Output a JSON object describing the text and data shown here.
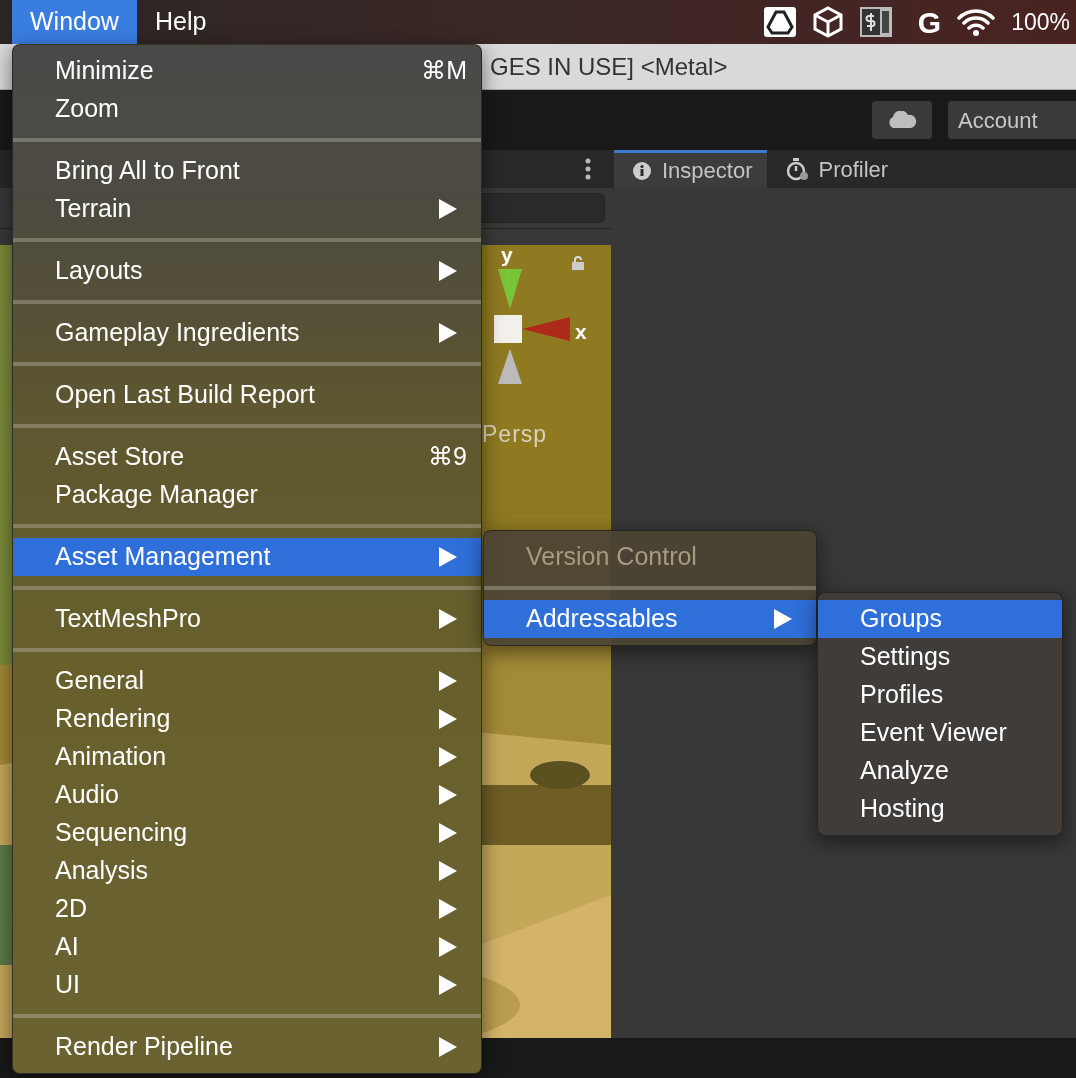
{
  "menu_bar": {
    "menus": [
      {
        "label": "Window",
        "selected": true
      },
      {
        "label": "Help",
        "selected": false
      }
    ],
    "status_letter": "G",
    "battery": "100%"
  },
  "window_title": "GES IN USE] <Metal>",
  "toolbar": {
    "account_button": "Account"
  },
  "scene": {
    "axis_y": "y",
    "axis_x": "x",
    "projection": "Persp"
  },
  "inspector_tabs": [
    {
      "label": "Inspector",
      "selected": true
    },
    {
      "label": "Profiler",
      "selected": false
    }
  ],
  "window_menu": {
    "sections": [
      [
        {
          "label": "Minimize",
          "shortcut": "⌘M",
          "submenu": false,
          "selected": false
        },
        {
          "label": "Zoom",
          "submenu": false,
          "selected": false
        }
      ],
      [
        {
          "label": "Bring All to Front",
          "submenu": false,
          "selected": false
        },
        {
          "label": "Terrain",
          "submenu": true,
          "selected": false
        }
      ],
      [
        {
          "label": "Layouts",
          "submenu": true,
          "selected": false
        }
      ],
      [
        {
          "label": "Gameplay Ingredients",
          "submenu": true,
          "selected": false
        }
      ],
      [
        {
          "label": "Open Last Build Report",
          "submenu": false,
          "selected": false
        }
      ],
      [
        {
          "label": "Asset Store",
          "shortcut": "⌘9",
          "submenu": false,
          "selected": false
        },
        {
          "label": "Package Manager",
          "submenu": false,
          "selected": false
        }
      ],
      [
        {
          "label": "Asset Management",
          "submenu": true,
          "selected": true
        }
      ],
      [
        {
          "label": "TextMeshPro",
          "submenu": true,
          "selected": false
        }
      ],
      [
        {
          "label": "General",
          "submenu": true,
          "selected": false
        },
        {
          "label": "Rendering",
          "submenu": true,
          "selected": false
        },
        {
          "label": "Animation",
          "submenu": true,
          "selected": false
        },
        {
          "label": "Audio",
          "submenu": true,
          "selected": false
        },
        {
          "label": "Sequencing",
          "submenu": true,
          "selected": false
        },
        {
          "label": "Analysis",
          "submenu": true,
          "selected": false
        },
        {
          "label": "2D",
          "submenu": true,
          "selected": false
        },
        {
          "label": "AI",
          "submenu": true,
          "selected": false
        },
        {
          "label": "UI",
          "submenu": true,
          "selected": false
        }
      ],
      [
        {
          "label": "Render Pipeline",
          "submenu": true,
          "selected": false
        }
      ]
    ]
  },
  "asset_management_submenu": {
    "sections": [
      [
        {
          "label": "Version Control",
          "submenu": false,
          "selected": false,
          "disabled": true
        }
      ],
      [
        {
          "label": "Addressables",
          "submenu": true,
          "selected": true,
          "disabled": false
        }
      ]
    ]
  },
  "addressables_submenu": {
    "sections": [
      [
        {
          "label": "Groups",
          "submenu": false,
          "selected": true
        },
        {
          "label": "Settings",
          "submenu": false,
          "selected": false
        },
        {
          "label": "Profiles",
          "submenu": false,
          "selected": false
        },
        {
          "label": "Event Viewer",
          "submenu": false,
          "selected": false
        },
        {
          "label": "Analyze",
          "submenu": false,
          "selected": false
        },
        {
          "label": "Hosting",
          "submenu": false,
          "selected": false
        }
      ]
    ]
  }
}
